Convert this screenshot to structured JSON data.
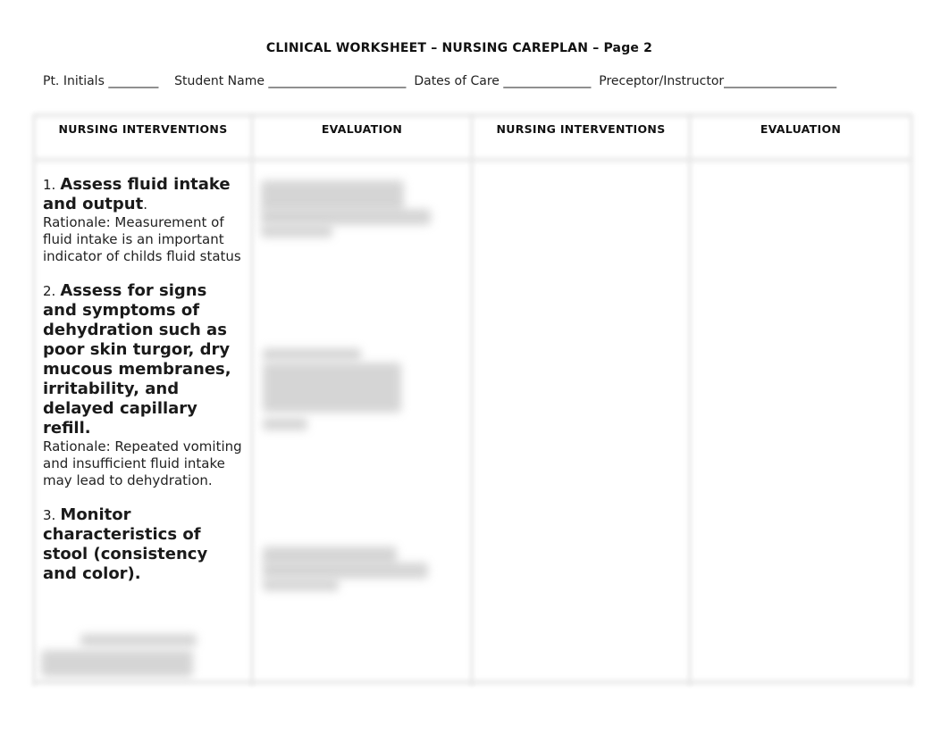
{
  "document": {
    "title": "CLINICAL WORKSHEET – NURSING CAREPLAN – Page 2",
    "info_line": "Pt. Initials ________    Student Name ______________________  Dates of Care ______________  Preceptor/Instructor__________________",
    "fields": [
      {
        "label": "Pt. Initials",
        "value": ""
      },
      {
        "label": "Student Name",
        "value": ""
      },
      {
        "label": "Dates of Care",
        "value": ""
      },
      {
        "label": "Preceptor/Instructor",
        "value": ""
      }
    ]
  },
  "table": {
    "headers": [
      "NURSING INTERVENTIONS",
      "EVALUATION",
      "NURSING INTERVENTIONS",
      "EVALUATION"
    ],
    "interventions": [
      {
        "number": "1.",
        "heading": "Assess fluid intake and output",
        "heading_suffix": ".",
        "rationale": "Rationale: Measurement of fluid intake is an important indicator of childs fluid status"
      },
      {
        "number": "2.",
        "heading": "Assess for signs and symptoms of dehydration such as poor skin turgor, dry mucous membranes, irritability, and delayed capillary refill.",
        "heading_suffix": "",
        "rationale": "Rationale: Repeated vomiting and insufficient fluid intake may lead to dehydration."
      },
      {
        "number": "3.",
        "heading": "Monitor characteristics of stool (consistency and color).",
        "heading_suffix": "",
        "rationale": ""
      }
    ],
    "evaluation_obscured": true
  }
}
